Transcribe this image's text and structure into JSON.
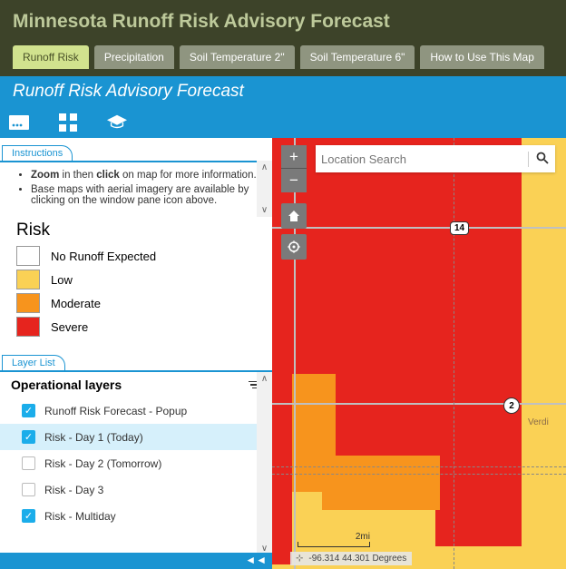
{
  "header": {
    "title": "Minnesota Runoff Risk Advisory Forecast",
    "tabs": [
      "Runoff Risk",
      "Precipitation",
      "Soil Temperature 2\"",
      "Soil Temperature 6\"",
      "How to Use This Map"
    ],
    "active_tab": 0
  },
  "app": {
    "title": "Runoff Risk Advisory Forecast"
  },
  "instructions": {
    "tab_label": "Instructions",
    "bullets_html": [
      "<b>Zoom</b> in then <b>click</b> on map for more information.",
      "Base maps with aerial imagery are available by clicking on the window pane icon above."
    ]
  },
  "risk_legend": {
    "title": "Risk",
    "items": [
      {
        "label": "No Runoff Expected",
        "color": "#ffffff"
      },
      {
        "label": "Low",
        "color": "#fad155"
      },
      {
        "label": "Moderate",
        "color": "#f7941d"
      },
      {
        "label": "Severe",
        "color": "#e6241e"
      }
    ]
  },
  "layer_list": {
    "tab_label": "Layer List",
    "heading": "Operational layers",
    "items": [
      {
        "label": "Runoff Risk Forecast - Popup",
        "checked": true,
        "selected": false
      },
      {
        "label": "Risk - Day 1 (Today)",
        "checked": true,
        "selected": true
      },
      {
        "label": "Risk - Day 2 (Tomorrow)",
        "checked": false,
        "selected": false
      },
      {
        "label": "Risk - Day 3",
        "checked": false,
        "selected": false
      },
      {
        "label": "Risk - Multiday",
        "checked": true,
        "selected": false
      }
    ]
  },
  "map": {
    "search_placeholder": "Location Search",
    "route_shields": {
      "us14": "14",
      "hwy2": "2"
    },
    "place_label": "Verdi",
    "scalebar": "2mi",
    "coords": "-96.314 44.301 Degrees"
  }
}
